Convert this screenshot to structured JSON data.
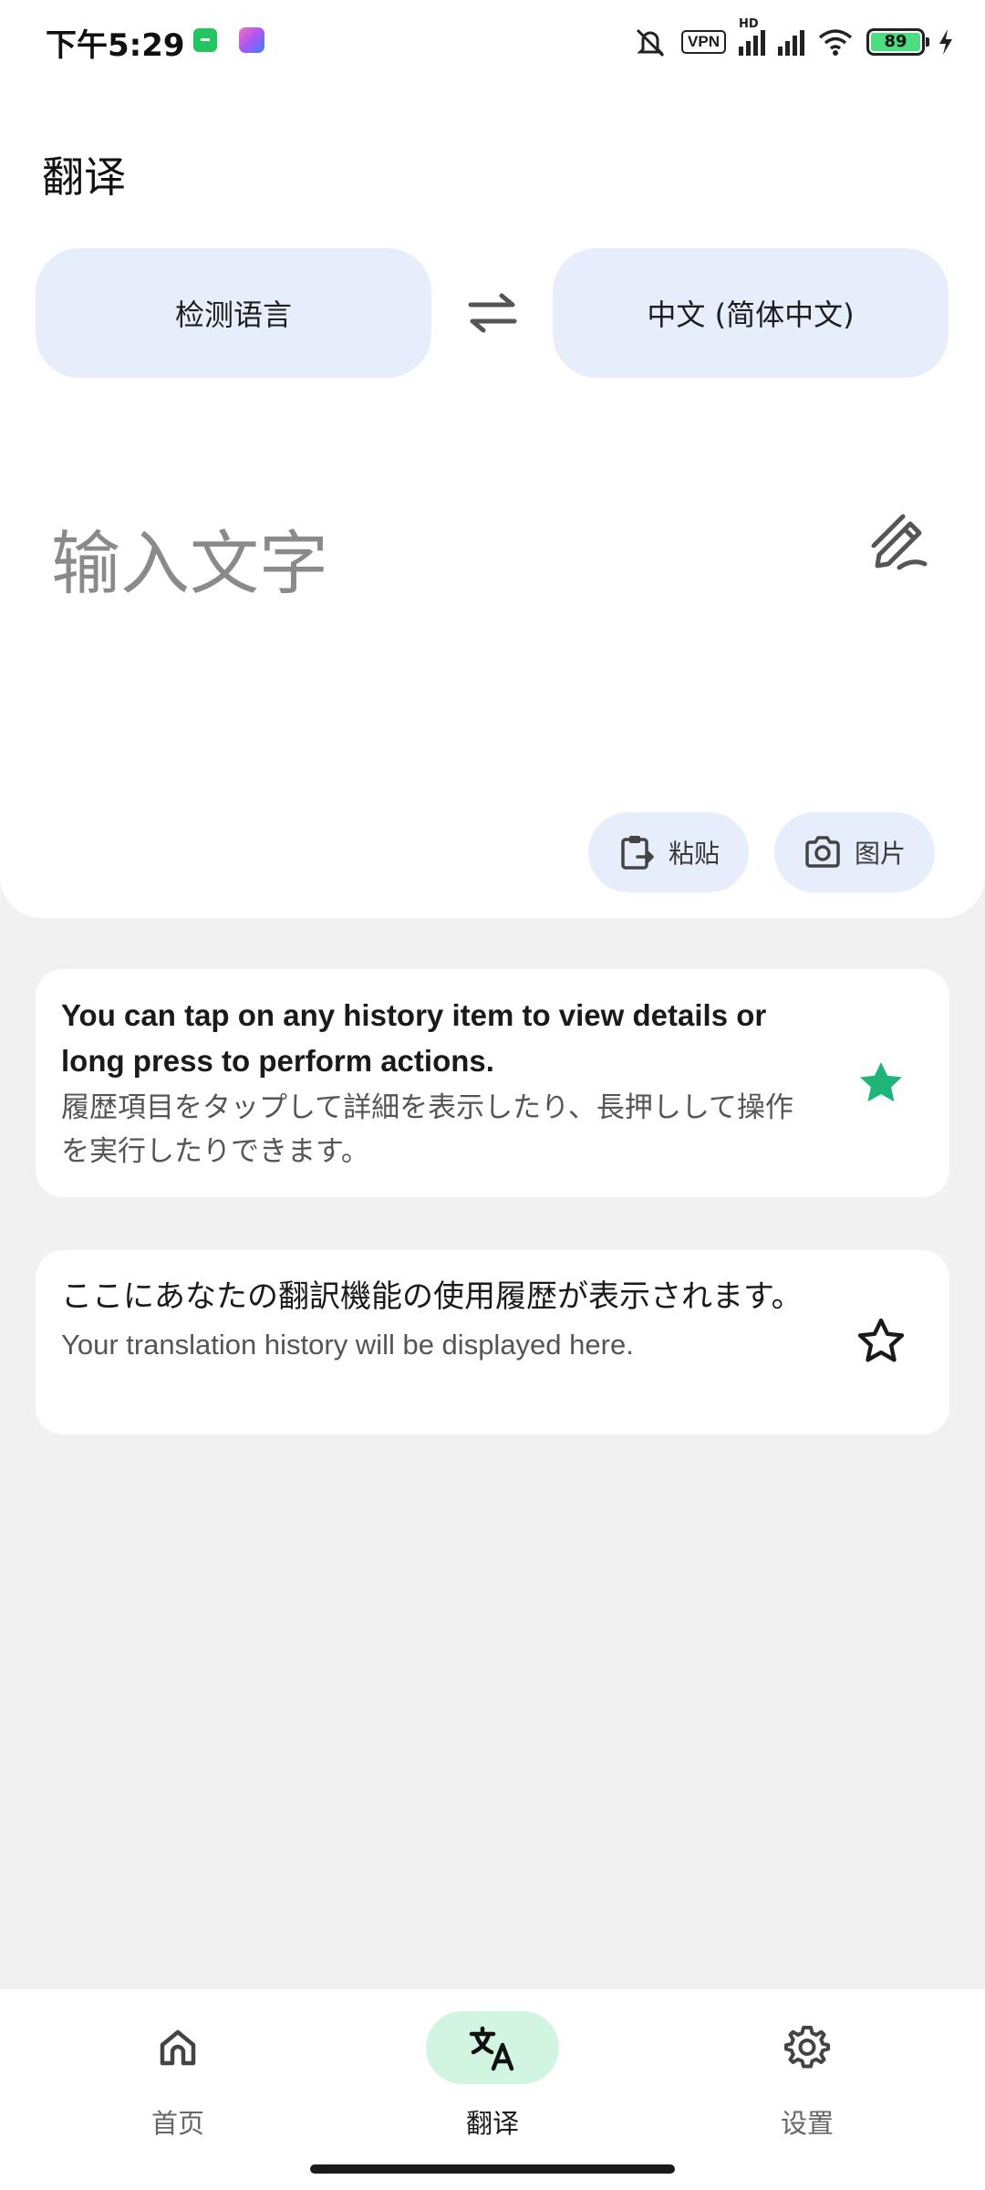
{
  "status_bar": {
    "time": "下午5:29",
    "vpn": "VPN",
    "network": "HD",
    "battery": "89",
    "icons": [
      "download-icon",
      "app-icon",
      "mute-icon",
      "signal-icon",
      "signal-icon",
      "wifi-icon",
      "battery-icon",
      "charging-icon"
    ]
  },
  "header": {
    "title": "翻译"
  },
  "languages": {
    "source": "检测语言",
    "target": "中文 (简体中文)",
    "swap_icon": "swap-icon"
  },
  "input": {
    "placeholder": "输入文字",
    "handwrite_icon": "handwriting-icon"
  },
  "actions": {
    "paste_label": "粘贴",
    "image_label": "图片"
  },
  "history": [
    {
      "primary": "You can tap on any history item to view details or long press to perform actions.",
      "secondary": "履歴項目をタップして詳細を表示したり、長押しして操作を実行したりできます。",
      "starred": true
    },
    {
      "primary": "ここにあなたの翻訳機能の使用履歴が表示されます。",
      "secondary": "Your translation history will be displayed here.",
      "starred": false
    }
  ],
  "nav": {
    "home": "首页",
    "translate": "翻译",
    "settings": "设置",
    "active": "translate"
  },
  "colors": {
    "accent_green": "#1fb57a",
    "chip_bg": "#e6eefb",
    "nav_active_bg": "#d2f5e2"
  }
}
